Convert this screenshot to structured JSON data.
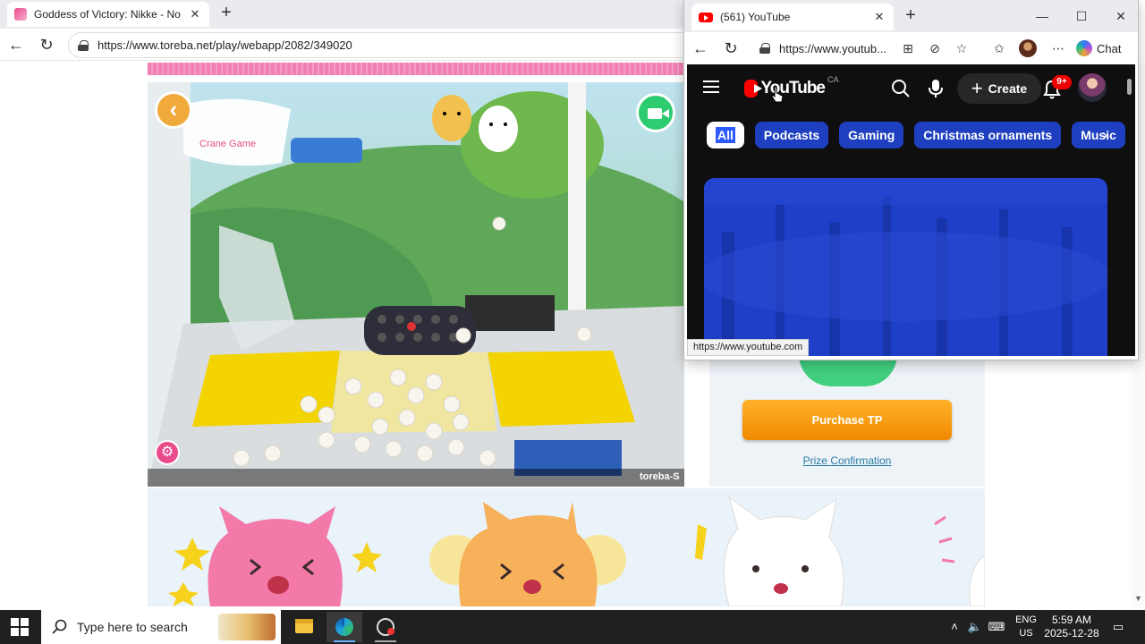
{
  "back_window": {
    "tab_title": "Goddess of Victory: Nikke - Nood",
    "url": "https://www.toreba.net/play/webapp/2082/349020",
    "game": {
      "brand_text": "toreba-S"
    },
    "purchase_label": "Purchase TP",
    "prize_link": "Prize Confirmation"
  },
  "front_window": {
    "tab_title": "(561) YouTube",
    "url": "https://www.youtub...",
    "chat_label": "Chat",
    "status_url": "https://www.youtube.com",
    "youtube": {
      "logo_text": "YouTube",
      "region": "CA",
      "create_label": "Create",
      "notifications": "9+",
      "chips": [
        "All",
        "Podcasts",
        "Gaming",
        "Christmas ornaments",
        "Music"
      ],
      "active_chip": 0
    }
  },
  "taskbar": {
    "search_placeholder": "Type here to search",
    "lang_top": "ENG",
    "lang_bottom": "US",
    "time": "5:59 AM",
    "date": "2025-12-28"
  },
  "colors": {
    "youtube_red": "#ff0000",
    "purchase_orange": "#f59a10",
    "chip_blue": "#1e3fbf",
    "toreba_pink": "#f27fb3"
  },
  "icons": [
    "back-icon",
    "reload-icon",
    "lock-icon",
    "plus-icon",
    "close-icon",
    "minimize-icon",
    "maximize-icon",
    "hamburger-icon",
    "search-icon",
    "mic-icon",
    "bell-icon",
    "chevron-right-icon",
    "windows-start-icon",
    "settings-gear-icon",
    "camera-icon"
  ]
}
